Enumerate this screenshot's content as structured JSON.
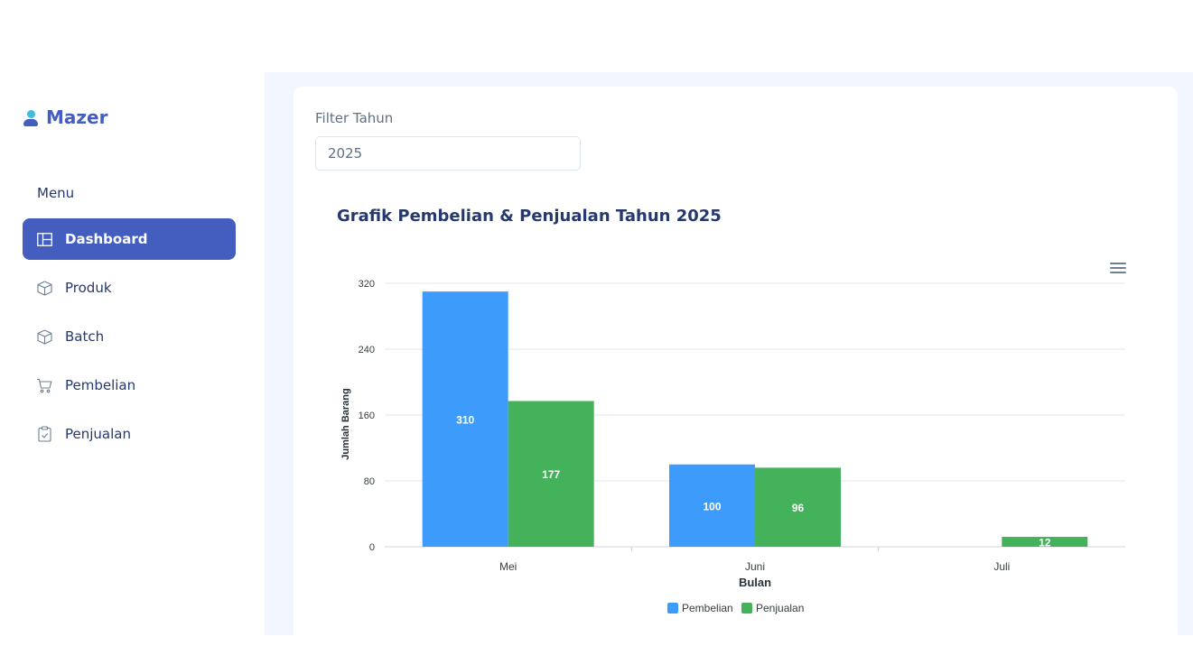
{
  "sidebar": {
    "brand": "Mazer",
    "menu_title": "Menu",
    "items": [
      {
        "label": "Dashboard",
        "icon": "grid-icon",
        "active": true
      },
      {
        "label": "Produk",
        "icon": "box-icon",
        "active": false
      },
      {
        "label": "Batch",
        "icon": "box-icon",
        "active": false
      },
      {
        "label": "Pembelian",
        "icon": "cart-icon",
        "active": false
      },
      {
        "label": "Penjualan",
        "icon": "clipboard-check-icon",
        "active": false
      }
    ]
  },
  "filter": {
    "label": "Filter Tahun",
    "value": "2025"
  },
  "chart_data": {
    "type": "bar",
    "title": "Grafik Pembelian & Penjualan Tahun 2025",
    "xlabel": "Bulan",
    "ylabel": "Jumlah Barang",
    "categories": [
      "Mei",
      "Juni",
      "Juli"
    ],
    "series": [
      {
        "name": "Pembelian",
        "color": "#3d9cfb",
        "values": [
          310,
          100,
          0
        ]
      },
      {
        "name": "Penjualan",
        "color": "#44b15b",
        "values": [
          177,
          96,
          12
        ]
      }
    ],
    "yticks": [
      0,
      80,
      160,
      240,
      320
    ],
    "ylim": [
      0,
      320
    ],
    "grid": true,
    "legend": "bottom-center"
  }
}
